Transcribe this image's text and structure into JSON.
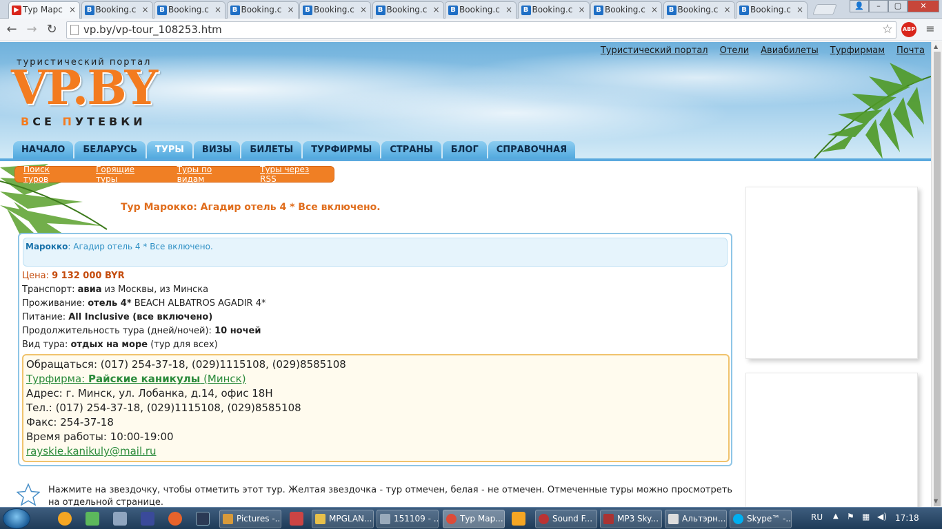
{
  "browser": {
    "tabs": [
      {
        "label": "Тур Марс",
        "favicon": "youtube-like",
        "active": true
      },
      {
        "label": "Booking.c"
      },
      {
        "label": "Booking.c"
      },
      {
        "label": "Booking.c"
      },
      {
        "label": "Booking.c"
      },
      {
        "label": "Booking.c"
      },
      {
        "label": "Booking.c"
      },
      {
        "label": "Booking.c"
      },
      {
        "label": "Booking.c"
      },
      {
        "label": "Booking.c"
      },
      {
        "label": "Booking.c"
      }
    ],
    "url": "vp.by/vp-tour_108253.htm",
    "abp_label": "ABP"
  },
  "header": {
    "tagline": "туристический портал",
    "logo": "VP.BY",
    "logo_sub_1": "В",
    "logo_sub_2": "СЕ ",
    "logo_sub_3": "П",
    "logo_sub_4": "УТЕВКИ",
    "top_links": [
      "Туристический портал",
      "Отели",
      "Авиабилеты",
      "Турфирмам",
      "Почта"
    ]
  },
  "main_nav": [
    "НАЧАЛО",
    "БЕЛАРУСЬ",
    "ТУРЫ",
    "ВИЗЫ",
    "БИЛЕТЫ",
    "ТУРФИРМЫ",
    "СТРАНЫ",
    "БЛОГ",
    "СПРАВОЧНАЯ"
  ],
  "sub_nav": [
    "Поиск туров",
    "Горящие туры",
    "Туры по видам",
    "Туры через RSS"
  ],
  "tour": {
    "title": "Тур Марокко: Агадир отель 4 * Все включено.",
    "country": "Марокко",
    "summary": ": Агадир отель 4 * Все включено.",
    "price_label": "Цена: ",
    "price": "9 132 000 BYR",
    "transport_label": "Транспорт: ",
    "transport": "авиа",
    "transport_from": " из Москвы, из Минска",
    "lodging_label": "Проживание: ",
    "lodging": "отель 4*",
    "lodging_hotel": " BEACH ALBATROS AGADIR 4*",
    "food_label": "Питание: ",
    "food": "All Inclusive (все включено)",
    "duration_label": "Продолжительность тура (дней/ночей): ",
    "duration": "10 ночей",
    "type_label": "Вид тура: ",
    "type": "отдых на море",
    "type_note": " (тур для всех)"
  },
  "contact": {
    "contact_line": "Обращаться: (017) 254-37-18, (029)1115108, (029)8585108",
    "firm_label": "Турфирма: ",
    "firm_name": "Райские каникулы",
    "firm_city": " (Минск)",
    "address": "Адрес: г. Минск, ул. Лобанка, д.14, офис 18Н",
    "phone": "Тел.: (017) 254-37-18, (029)1115108, (029)8585108",
    "fax": "Факс: 254-37-18",
    "hours": "Время работы: 10:00-19:00",
    "email": "rayskie.kanikuly@mail.ru"
  },
  "note": "Нажмите на звездочку, чтобы отметить этот тур. Желтая звездочка - тур отмечен, белая - не отмечен. Отмеченные туры можно просмотреть на отдельной странице.",
  "taskbar": {
    "buttons": [
      "Pictures -...",
      "MPGLAN...",
      "151109 - ...",
      "Тур Мар...",
      "Sound F...",
      "MP3 Sky...",
      "Альтэрн...",
      "Skype™ -..."
    ],
    "lang": "RU",
    "time": "17:18"
  },
  "colors": {
    "accent_orange": "#f07f24",
    "nav_blue": "#52a9de",
    "title_orange": "#e06d1c"
  }
}
